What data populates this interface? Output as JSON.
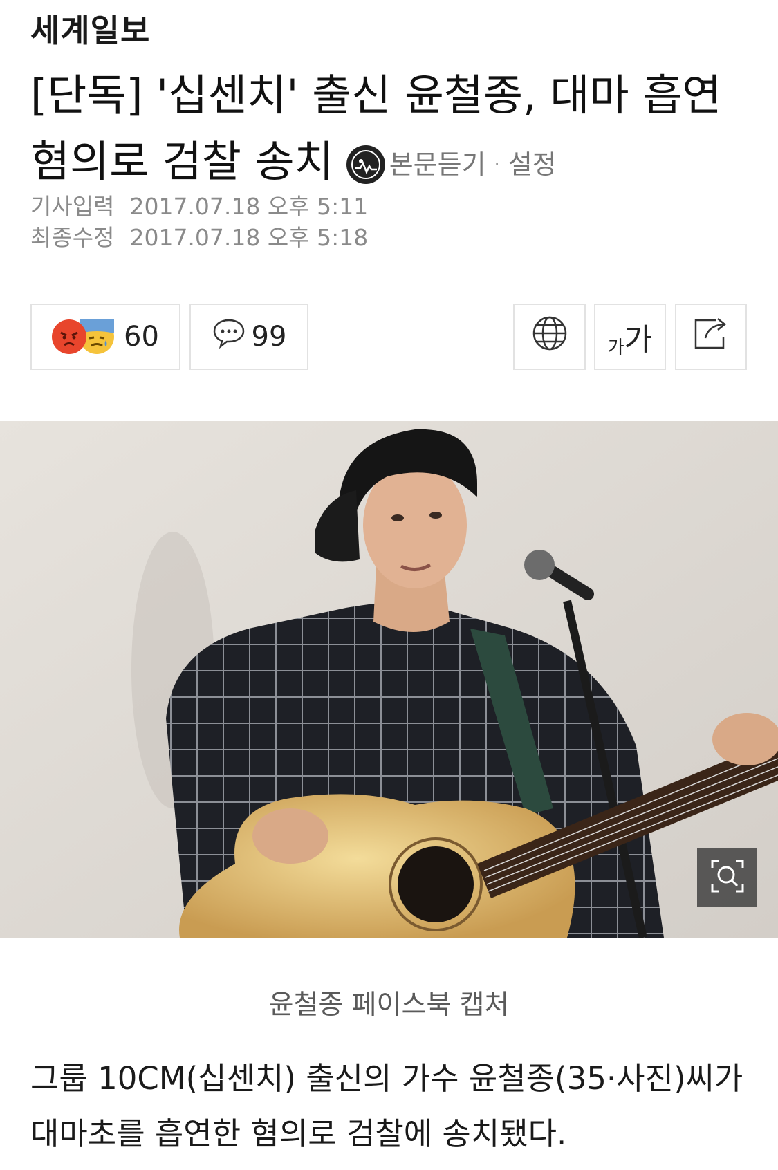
{
  "press": {
    "name": "세계일보"
  },
  "article": {
    "title": "[단독] '십센치' 출신 윤철종, 대마 흡연 혐의로 검찰 송치",
    "tts_label": "본문듣기",
    "tts_separator": "·",
    "settings_label": "설정",
    "published_label": "기사입력",
    "published_value": "2017.07.18 오후 5:11",
    "modified_label": "최종수정",
    "modified_value": "2017.07.18 오후 5:18",
    "photo_caption": "윤철종 페이스북 캡처",
    "body": "그룹 10CM(십센치) 출신의 가수 윤철종(35·사진)씨가 대마초를 흡연한 혐의로 검찰에 송치됐다."
  },
  "actions": {
    "reaction_count": "60",
    "comment_count": "99",
    "font_size_label_small": "가",
    "font_size_label_large": "가",
    "icons": [
      "angry-emoji-icon",
      "sad-emoji-icon",
      "comment-icon",
      "globe-icon",
      "font-size-icon",
      "share-icon",
      "zoom-icon",
      "tts-icon"
    ]
  },
  "colors": {
    "text": "#1a1a1a",
    "meta_text": "#8a8a8a",
    "border": "#e2e2e2",
    "angry_emoji": "#e8452c",
    "sad_emoji": "#f5c33b"
  }
}
